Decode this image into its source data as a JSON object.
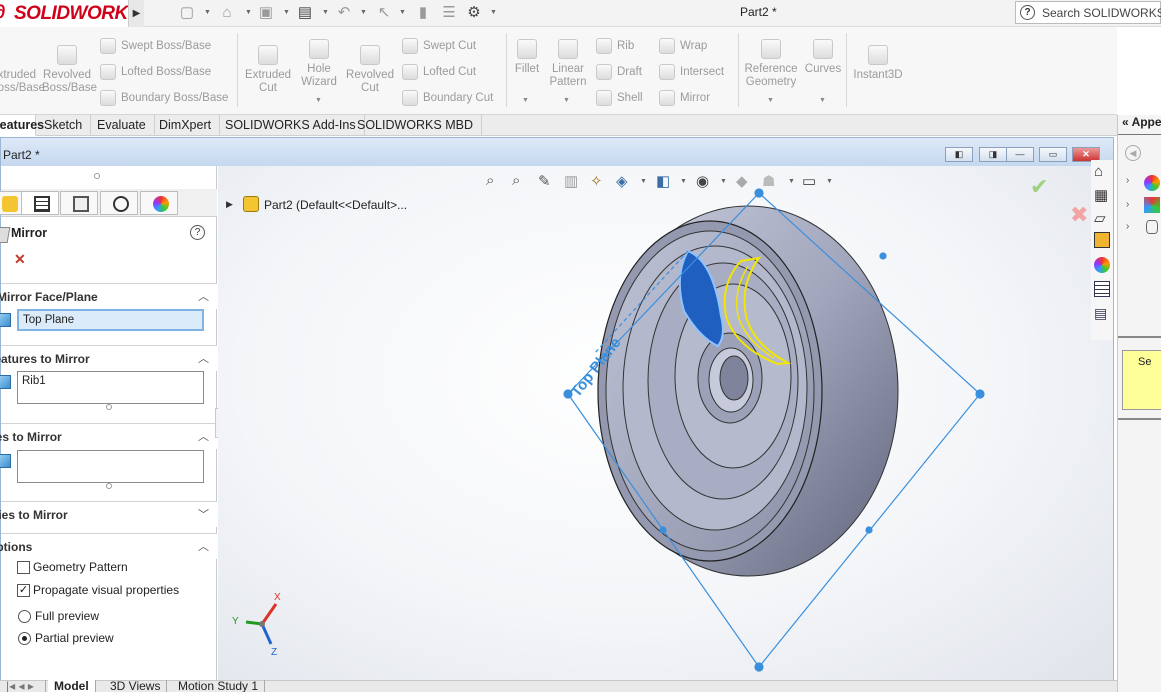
{
  "app": {
    "brand": "SOLIDWORKS",
    "document_title": "Part2 *",
    "search_placeholder": "Search SOLIDWORKS Help"
  },
  "ribbon": {
    "items": [
      {
        "label": "Extruded Boss/Base"
      },
      {
        "label": "Revolved Boss/Base"
      },
      {
        "label": "Swept Boss/Base"
      },
      {
        "label": "Lofted Boss/Base"
      },
      {
        "label": "Boundary Boss/Base"
      },
      {
        "label": "Extruded Cut"
      },
      {
        "label": "Hole Wizard"
      },
      {
        "label": "Revolved Cut"
      },
      {
        "label": "Swept Cut"
      },
      {
        "label": "Lofted Cut"
      },
      {
        "label": "Boundary Cut"
      },
      {
        "label": "Fillet"
      },
      {
        "label": "Linear Pattern"
      },
      {
        "label": "Rib"
      },
      {
        "label": "Draft"
      },
      {
        "label": "Shell"
      },
      {
        "label": "Wrap"
      },
      {
        "label": "Intersect"
      },
      {
        "label": "Mirror"
      },
      {
        "label": "Reference Geometry"
      },
      {
        "label": "Curves"
      },
      {
        "label": "Instant3D"
      }
    ]
  },
  "tabs": [
    "Features",
    "Sketch",
    "Evaluate",
    "DimXpert",
    "SOLIDWORKS Add-Ins",
    "SOLIDWORKS MBD"
  ],
  "right_panel": {
    "title": "Appearances"
  },
  "doc_window": {
    "title": "Part2 *"
  },
  "property_manager": {
    "title": "Mirror",
    "sections": {
      "mirror_face_plane": {
        "title": "Mirror Face/Plane",
        "value": "Top Plane"
      },
      "features_to_mirror": {
        "title": "Features to Mirror",
        "items": [
          "Rib1"
        ]
      },
      "faces_to_mirror": {
        "title": "Faces to Mirror"
      },
      "bodies_to_mirror": {
        "title": "Bodies to Mirror"
      },
      "options": {
        "title": "Options",
        "geometry_pattern": {
          "label": "Geometry Pattern",
          "checked": false
        },
        "propagate_visual": {
          "label": "Propagate visual properties",
          "checked": true
        },
        "full_preview": {
          "label": "Full preview",
          "selected": false
        },
        "partial_preview": {
          "label": "Partial preview",
          "selected": true
        }
      }
    }
  },
  "tree": {
    "root": "Part2  (Default<<Default>..."
  },
  "viewport": {
    "plane_label": "Top Plane",
    "triad": {
      "x": "X",
      "y": "Y",
      "z": "Z"
    }
  },
  "bottom_tabs": [
    "Model",
    "3D Views",
    "Motion Study 1"
  ],
  "colors": {
    "accent_blue": "#1f5fbf",
    "plane_line": "#3a8fdc",
    "highlight_yellow": "#f2e600",
    "brand_red": "#d0021b"
  }
}
